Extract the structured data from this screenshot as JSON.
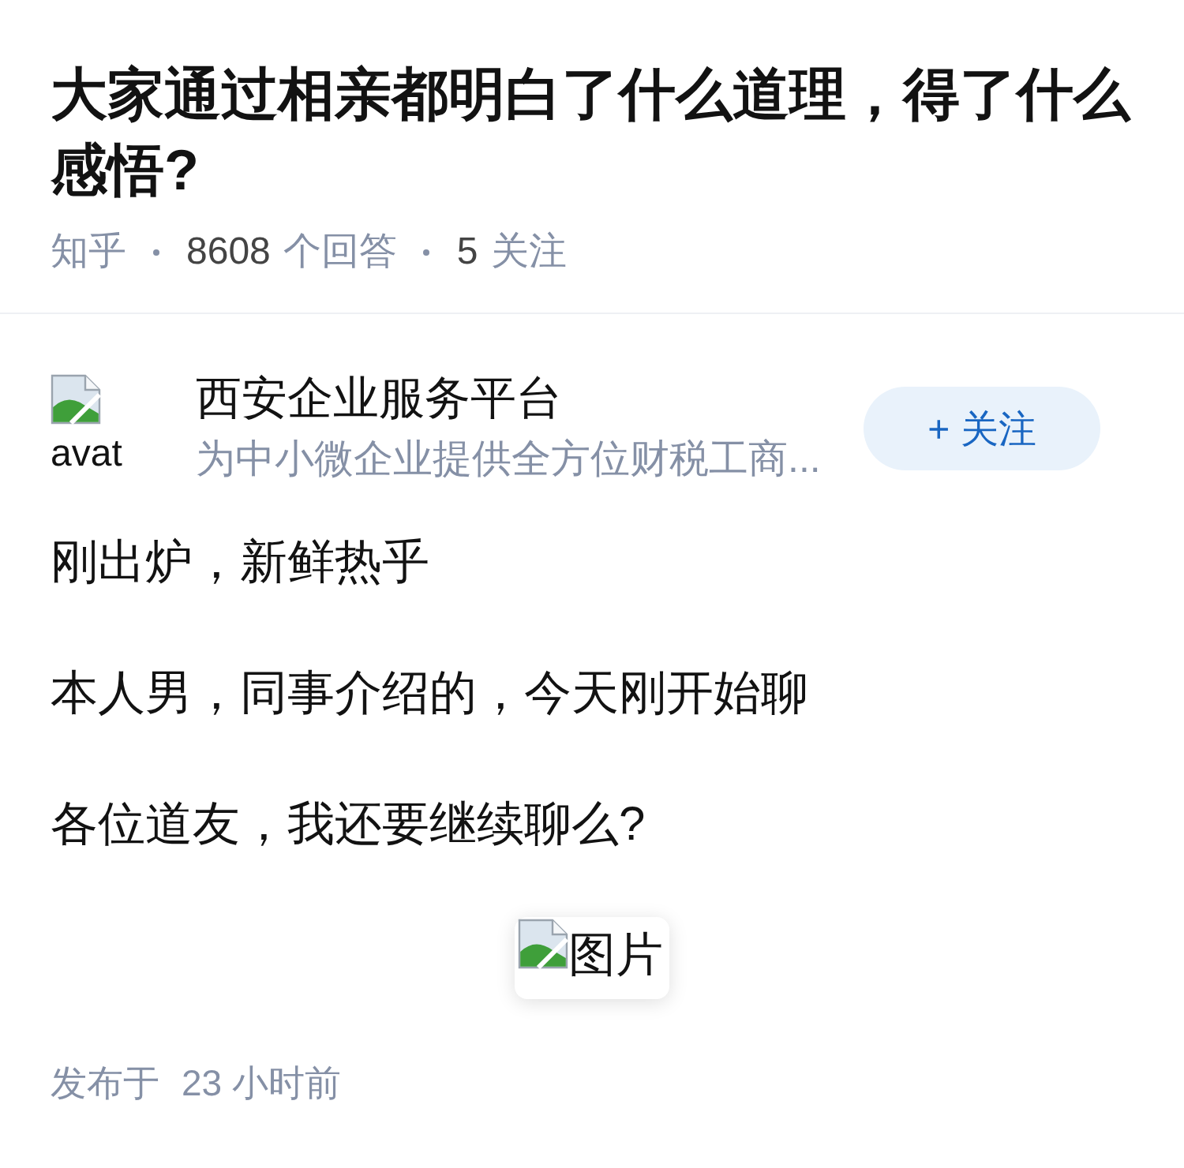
{
  "question": {
    "title": "大家通过相亲都明白了什么道理，得了什么感悟?",
    "meta": [
      {
        "kind": "source",
        "text": "知乎"
      },
      {
        "kind": "count",
        "count": "8608",
        "text": "个回答"
      },
      {
        "kind": "count",
        "count": "5",
        "text": "关注"
      }
    ]
  },
  "answer": {
    "author": {
      "avatar_alt": "avat",
      "name": "西安企业服务平台",
      "headline": "为中小微企业提供全方位财税工商...",
      "follow_button": "+ 关注"
    },
    "paragraphs": [
      "刚出炉，新鲜热乎",
      "本人男，同事介绍的，今天刚开始聊",
      "各位道友，我还要继续聊么?"
    ],
    "image": {
      "alt": "图片"
    },
    "published": {
      "label": "发布于",
      "time": "23 小时前"
    }
  }
}
